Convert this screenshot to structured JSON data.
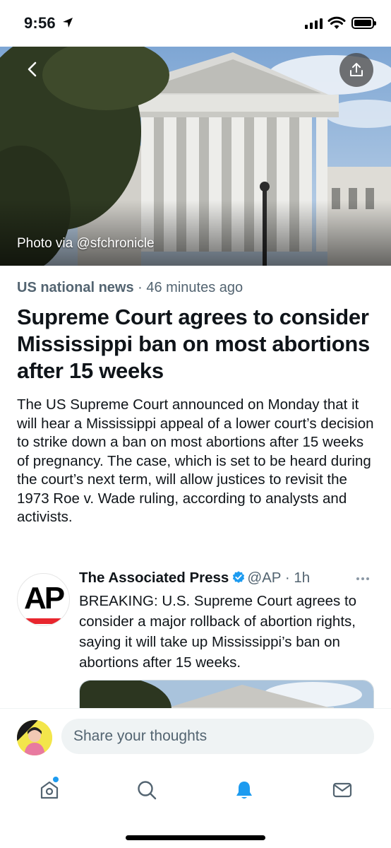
{
  "status_bar": {
    "time": "9:56",
    "icons": [
      "location-arrow-icon",
      "signal-icon",
      "wifi-icon",
      "battery-icon"
    ]
  },
  "hero": {
    "photo_credit": "Photo via @sfchronicle",
    "icons": [
      "back-icon",
      "share-icon"
    ]
  },
  "article": {
    "category": "US national news",
    "separator": " · ",
    "time_ago": "46 minutes ago",
    "headline": "Supreme Court agrees to consider Mississippi ban on most abortions after 15 weeks",
    "body": "The US Supreme Court announced on Monday that it will hear a Mississippi appeal of a lower court’s decision to strike down a ban on most abortions after 15 weeks of pregnancy. The case, which is set to be heard during the court’s next term, will allow justices to revisit the 1973 Roe v. Wade ruling, according to analysts and activists."
  },
  "tweet": {
    "avatar_text": "AP",
    "author_name": "The Associated Press",
    "handle": "@AP",
    "time": "· 1h",
    "text": "BREAKING: U.S. Supreme Court agrees to consider a major rollback of abortion rights, saying it will take up Mississippi’s ban on abortions after 15 weeks.",
    "verified": true
  },
  "composer": {
    "placeholder": "Share your thoughts"
  },
  "tab_bar": {
    "tabs": [
      {
        "name": "home",
        "icon": "home-icon",
        "active": false,
        "has_dot": true
      },
      {
        "name": "search",
        "icon": "search-icon",
        "active": false
      },
      {
        "name": "notifications",
        "icon": "bell-icon",
        "active": true
      },
      {
        "name": "messages",
        "icon": "mail-icon",
        "active": false
      }
    ]
  },
  "colors": {
    "accent": "#1d9bf0",
    "secondary_text": "#536471",
    "primary_text": "#0f1419",
    "ap_red": "#e8262e"
  }
}
